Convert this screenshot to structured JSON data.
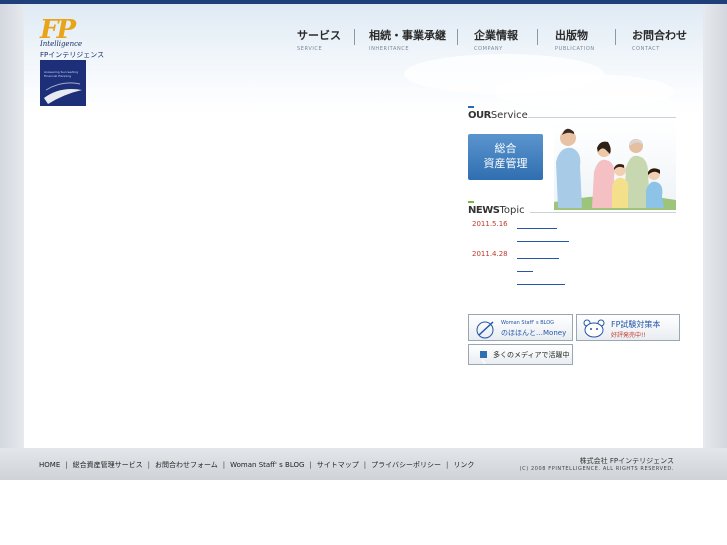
{
  "brand": {
    "logo_mark": "FP",
    "logo_sub": "Intelligence",
    "logo_jp": "FPインテリジェンス",
    "badge_text": "Answering Succeeding Financial Planning"
  },
  "nav": [
    {
      "jp": "サービス",
      "en": "SERVICE"
    },
    {
      "jp": "相続・事業承継",
      "en": "INHERITANCE"
    },
    {
      "jp": "企業情報",
      "en": "COMPANY"
    },
    {
      "jp": "出版物",
      "en": "PUBLICATION"
    },
    {
      "jp": "お問合わせ",
      "en": "CONTACT"
    }
  ],
  "service": {
    "heading_bold": "OUR",
    "heading_rest": "Service",
    "button_line1": "総合",
    "button_line2": "資産管理"
  },
  "news": {
    "heading_bold": "NEWS",
    "heading_rest": "Topic",
    "items": [
      {
        "date": "2011.5.16"
      },
      {
        "date": "2011.4.28"
      }
    ]
  },
  "banners": {
    "blog_title": "Woman Staff' s BLOG",
    "blog_sub": "のほほんと…Money",
    "exam_title": "FP試験対策本",
    "exam_sub": "好評発売中!!",
    "media": "多くのメディアで活躍中"
  },
  "footer": {
    "links": [
      "HOME",
      "総合資産管理サービス",
      "お問合わせフォーム",
      "Woman Staff' s BLOG",
      "サイトマップ",
      "プライバシーポリシー",
      "リンク"
    ],
    "company": "株式会社 FPインテリジェンス",
    "copyright": "(C) 2008 FPINTELLIGENCE. ALL RIGHTS RESERVED."
  },
  "colors": {
    "nav_bar": "#1f3f7a",
    "accent_orange": "#e8a51a",
    "link_blue": "#2456a8",
    "date_red": "#c0392b",
    "service_button": "#3a78b8"
  }
}
